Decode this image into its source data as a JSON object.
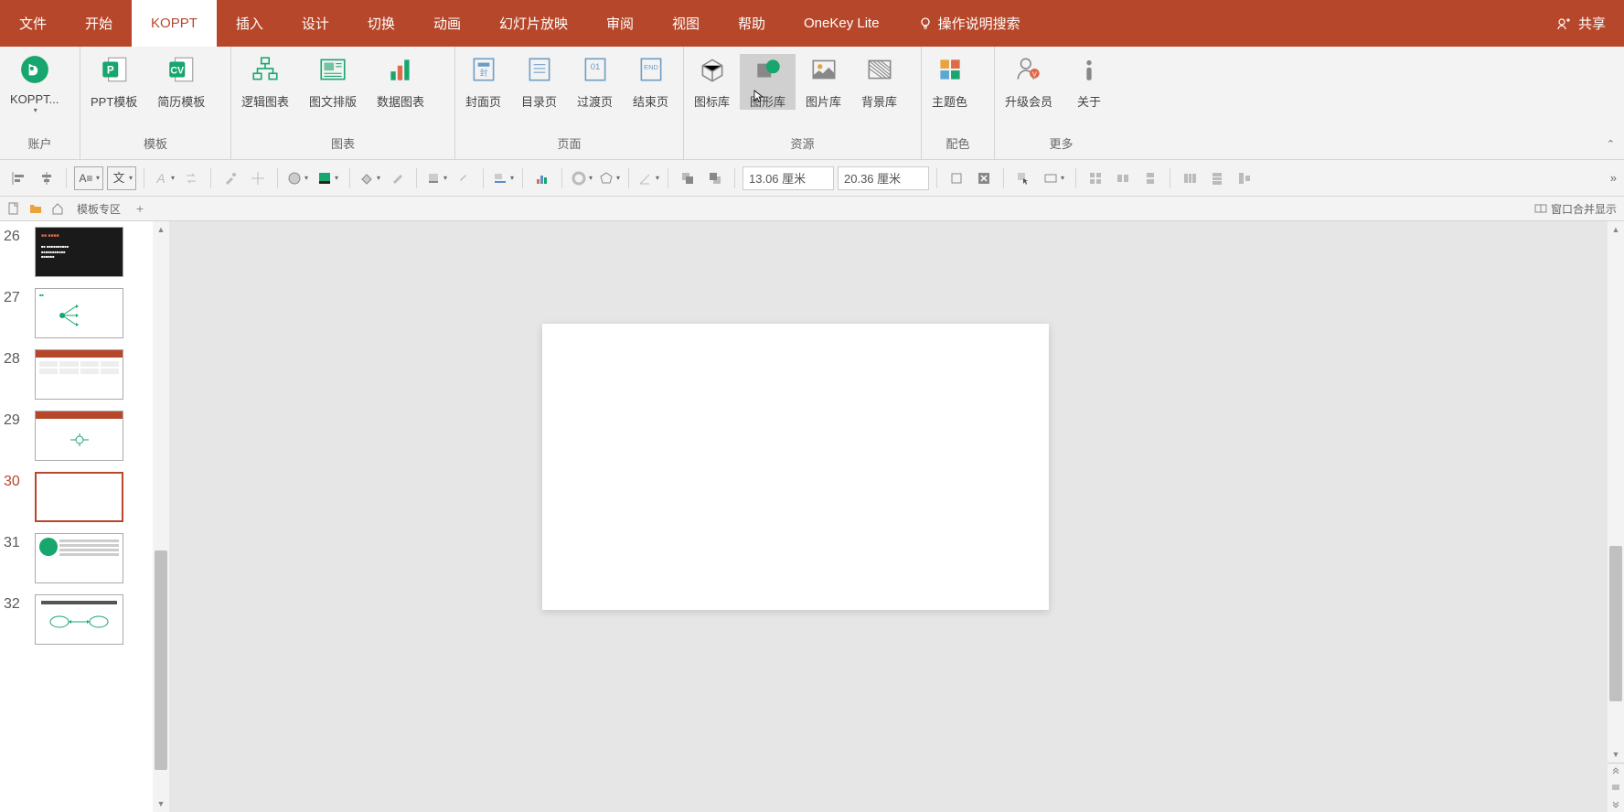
{
  "tabs": {
    "file": "文件",
    "home": "开始",
    "koppt": "KOPPT",
    "insert": "插入",
    "design": "设计",
    "transition": "切换",
    "animation": "动画",
    "slideshow": "幻灯片放映",
    "review": "审阅",
    "view": "视图",
    "help": "帮助",
    "onekey": "OneKey Lite",
    "search": "操作说明搜索"
  },
  "share": "共享",
  "ribbon": {
    "account": {
      "koppt": "KOPPT...",
      "group": "账户"
    },
    "template": {
      "ppt": "PPT模板",
      "resume": "简历模板",
      "group": "模板"
    },
    "chart": {
      "logic": "逻辑图表",
      "imgtxt": "图文排版",
      "data": "数据图表",
      "group": "图表"
    },
    "page": {
      "cover": "封面页",
      "toc": "目录页",
      "trans": "过渡页",
      "end": "结束页",
      "group": "页面"
    },
    "resource": {
      "icon": "图标库",
      "shape": "图形库",
      "image": "图片库",
      "bg": "背景库",
      "group": "资源"
    },
    "color": {
      "theme": "主题色",
      "group": "配色"
    },
    "more": {
      "upgrade": "升级会员",
      "about": "关于",
      "group": "更多"
    }
  },
  "toolbar": {
    "dim1": "13.06 厘米",
    "dim2": "20.36 厘米",
    "expand": "»"
  },
  "tabbar": {
    "area": "模板专区",
    "window": "窗口合并显示"
  },
  "thumbs": [
    {
      "n": "26",
      "active": false
    },
    {
      "n": "27",
      "active": false
    },
    {
      "n": "28",
      "active": false
    },
    {
      "n": "29",
      "active": false
    },
    {
      "n": "30",
      "active": true
    },
    {
      "n": "31",
      "active": false
    },
    {
      "n": "32",
      "active": false
    }
  ],
  "colors": {
    "accent": "#b7472a",
    "green": "#17a66d"
  }
}
